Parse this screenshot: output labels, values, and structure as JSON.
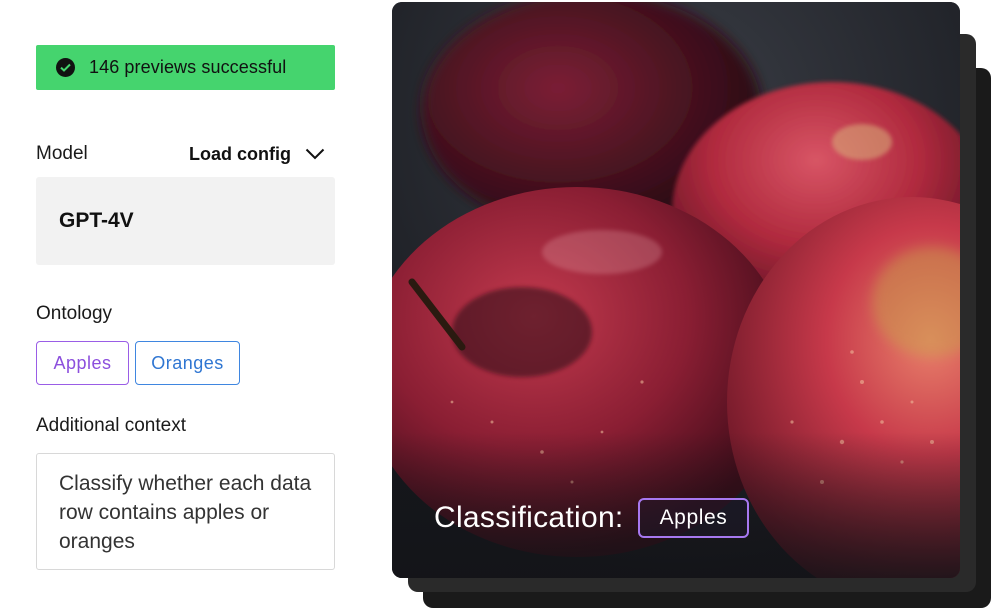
{
  "toast": {
    "text": "146 previews successful",
    "icon": "check-circle-icon"
  },
  "model": {
    "label": "Model",
    "load_config_label": "Load config",
    "value": "GPT-4V"
  },
  "ontology": {
    "label": "Ontology",
    "tags": [
      {
        "label": "Apples",
        "color": "#9a5de6"
      },
      {
        "label": "Oranges",
        "color": "#3f86e0"
      }
    ]
  },
  "context": {
    "label": "Additional context",
    "value": "Classify whether each data row contains apples or oranges"
  },
  "preview": {
    "classification_label": "Classification:",
    "classification_value": "Apples"
  },
  "colors": {
    "success": "#45d46e",
    "accent_purple": "#9a5de6",
    "accent_blue": "#3f86e0"
  }
}
